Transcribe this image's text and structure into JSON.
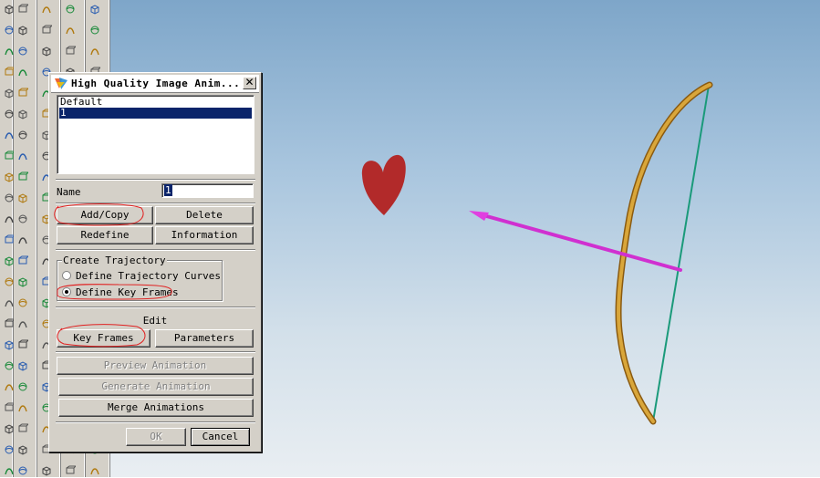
{
  "dialog": {
    "title": "High Quality Image Anim...",
    "close_label": "✕",
    "list_items": [
      "Default",
      "1"
    ],
    "selected_index": 1,
    "name_label": "Name",
    "name_value": "1",
    "buttons": {
      "add_copy": "Add/Copy",
      "delete": "Delete",
      "redefine": "Redefine",
      "information": "Information"
    },
    "trajectory": {
      "group_label": "Create Trajectory",
      "option_curves": "Define Trajectory Curves",
      "option_key_frames": "Define Key Frames",
      "selected": "key_frames"
    },
    "edit": {
      "label": "Edit",
      "key_frames": "Key Frames",
      "parameters": "Parameters"
    },
    "preview_animation": "Preview Animation",
    "generate_animation": "Generate Animation",
    "merge_animations": "Merge Animations",
    "ok": "OK",
    "cancel": "Cancel"
  },
  "colors": {
    "dialog_bg": "#d4d0c8",
    "selection": "#0a246a",
    "annotation": "#e02020",
    "heart": "#b22a2a",
    "bow": "#c8962a",
    "bowstring": "#1a9a7a",
    "arrow": "#e040e0"
  },
  "scene": {
    "objects": [
      "heart",
      "bow",
      "bowstring",
      "arrow"
    ]
  },
  "toolbar_icons": [
    "cube-icon",
    "sphere-icon",
    "surface-icon",
    "curve-icon",
    "extrude-icon",
    "revolve-icon",
    "sweep-icon",
    "blend-icon",
    "fillet-icon",
    "chamfer-icon",
    "hole-icon",
    "shell-icon",
    "rib-icon",
    "draft-icon",
    "mirror-icon",
    "pattern-icon",
    "datum-plane-icon",
    "datum-axis-icon",
    "datum-point-icon",
    "sketch-icon",
    "dimension-icon",
    "constraint-icon",
    "trim-icon",
    "offset-icon"
  ]
}
